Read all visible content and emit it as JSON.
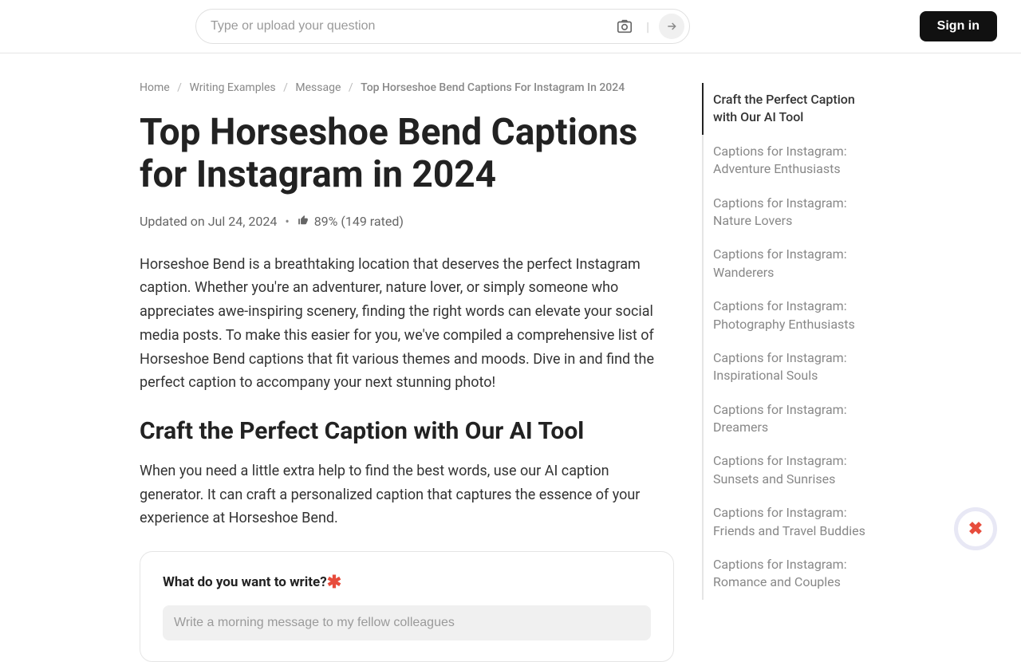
{
  "header": {
    "search_placeholder": "Type or upload your question",
    "sign_in": "Sign in"
  },
  "breadcrumb": {
    "home": "Home",
    "writing_examples": "Writing Examples",
    "message": "Message",
    "current": "Top Horseshoe Bend Captions For Instagram In 2024"
  },
  "article": {
    "title": "Top Horseshoe Bend Captions for Instagram in 2024",
    "updated": "Updated on Jul 24, 2024",
    "rating": "89% (149 rated)",
    "intro": "Horseshoe Bend is a breathtaking location that deserves the perfect Instagram caption. Whether you're an adventurer, nature lover, or simply someone who appreciates awe-inspiring scenery, finding the right words can elevate your social media posts. To make this easier for you, we've compiled a comprehensive list of Horseshoe Bend captions that fit various themes and moods. Dive in and find the perfect caption to accompany your next stunning photo!",
    "section1_heading": "Craft the Perfect Caption with Our AI Tool",
    "section1_text": "When you need a little extra help to find the best words, use our AI caption generator. It can craft a personalized caption that captures the essence of your experience at Horseshoe Bend.",
    "form_label": "What do you want to write?",
    "form_placeholder": "Write a morning message to my fellow colleagues"
  },
  "toc": {
    "items": [
      "Craft the Perfect Caption with Our AI Tool",
      "Captions for Instagram: Adventure Enthusiasts",
      "Captions for Instagram: Nature Lovers",
      "Captions for Instagram: Wanderers",
      "Captions for Instagram: Photography Enthusiasts",
      "Captions for Instagram: Inspirational Souls",
      "Captions for Instagram: Dreamers",
      "Captions for Instagram: Sunsets and Sunrises",
      "Captions for Instagram: Friends and Travel Buddies",
      "Captions for Instagram: Romance and Couples"
    ]
  }
}
